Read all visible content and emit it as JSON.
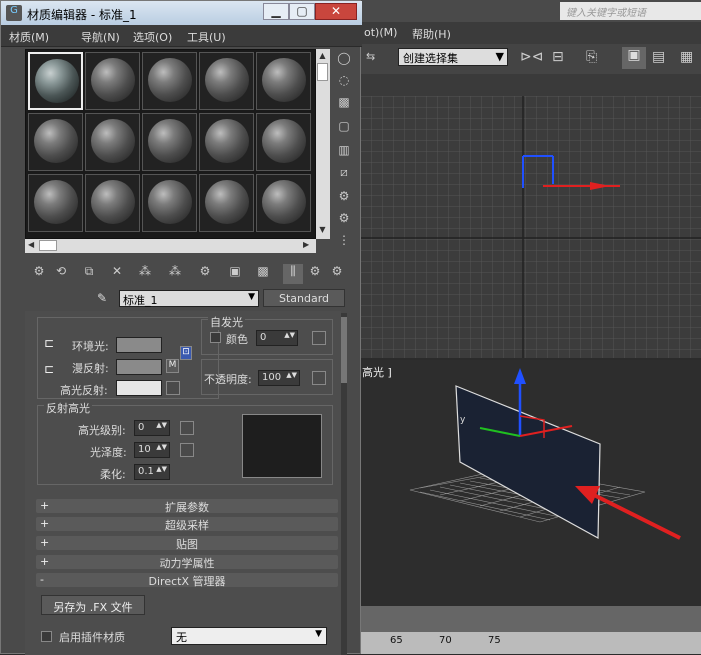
{
  "background": {
    "menu_help": "帮助(H)",
    "menu_partial": "ot)(M)",
    "search_placeholder": "键入关键字或短语",
    "selection_set": "创建选择集",
    "viewport_label": "高光 ]",
    "timeline_ticks": [
      "65",
      "70",
      "75"
    ]
  },
  "editor": {
    "title": "材质编辑器 - 标准_1",
    "menu": [
      "材质(M)",
      "导航(N)",
      "选项(O)",
      "工具(U)"
    ],
    "material_name": "标准_1",
    "material_type": "Standard",
    "basic": {
      "ambient": "环境光:",
      "diffuse": "漫反射:",
      "specular": "高光反射:",
      "map_btn": "M",
      "self_illum_title": "自发光",
      "color_label": "颜色",
      "color_value": "0",
      "opacity_label": "不透明度:",
      "opacity_value": "100"
    },
    "spec_highlights": {
      "title": "反射高光",
      "level_label": "高光级别:",
      "level_value": "0",
      "gloss_label": "光泽度:",
      "gloss_value": "10",
      "soften_label": "柔化:",
      "soften_value": "0.1"
    },
    "rollouts": [
      {
        "sign": "+",
        "label": "扩展参数"
      },
      {
        "sign": "+",
        "label": "超级采样"
      },
      {
        "sign": "+",
        "label": "贴图"
      },
      {
        "sign": "+",
        "label": "动力学属性"
      },
      {
        "sign": "-",
        "label": "DirectX 管理器"
      }
    ],
    "save_fx": "另存为 .FX 文件",
    "plugin_label": "启用插件材质",
    "plugin_value": "无"
  },
  "colors": {
    "accent_red": "#e02020",
    "gizmo_blue": "#2050ff",
    "plane": "#1a2233"
  }
}
